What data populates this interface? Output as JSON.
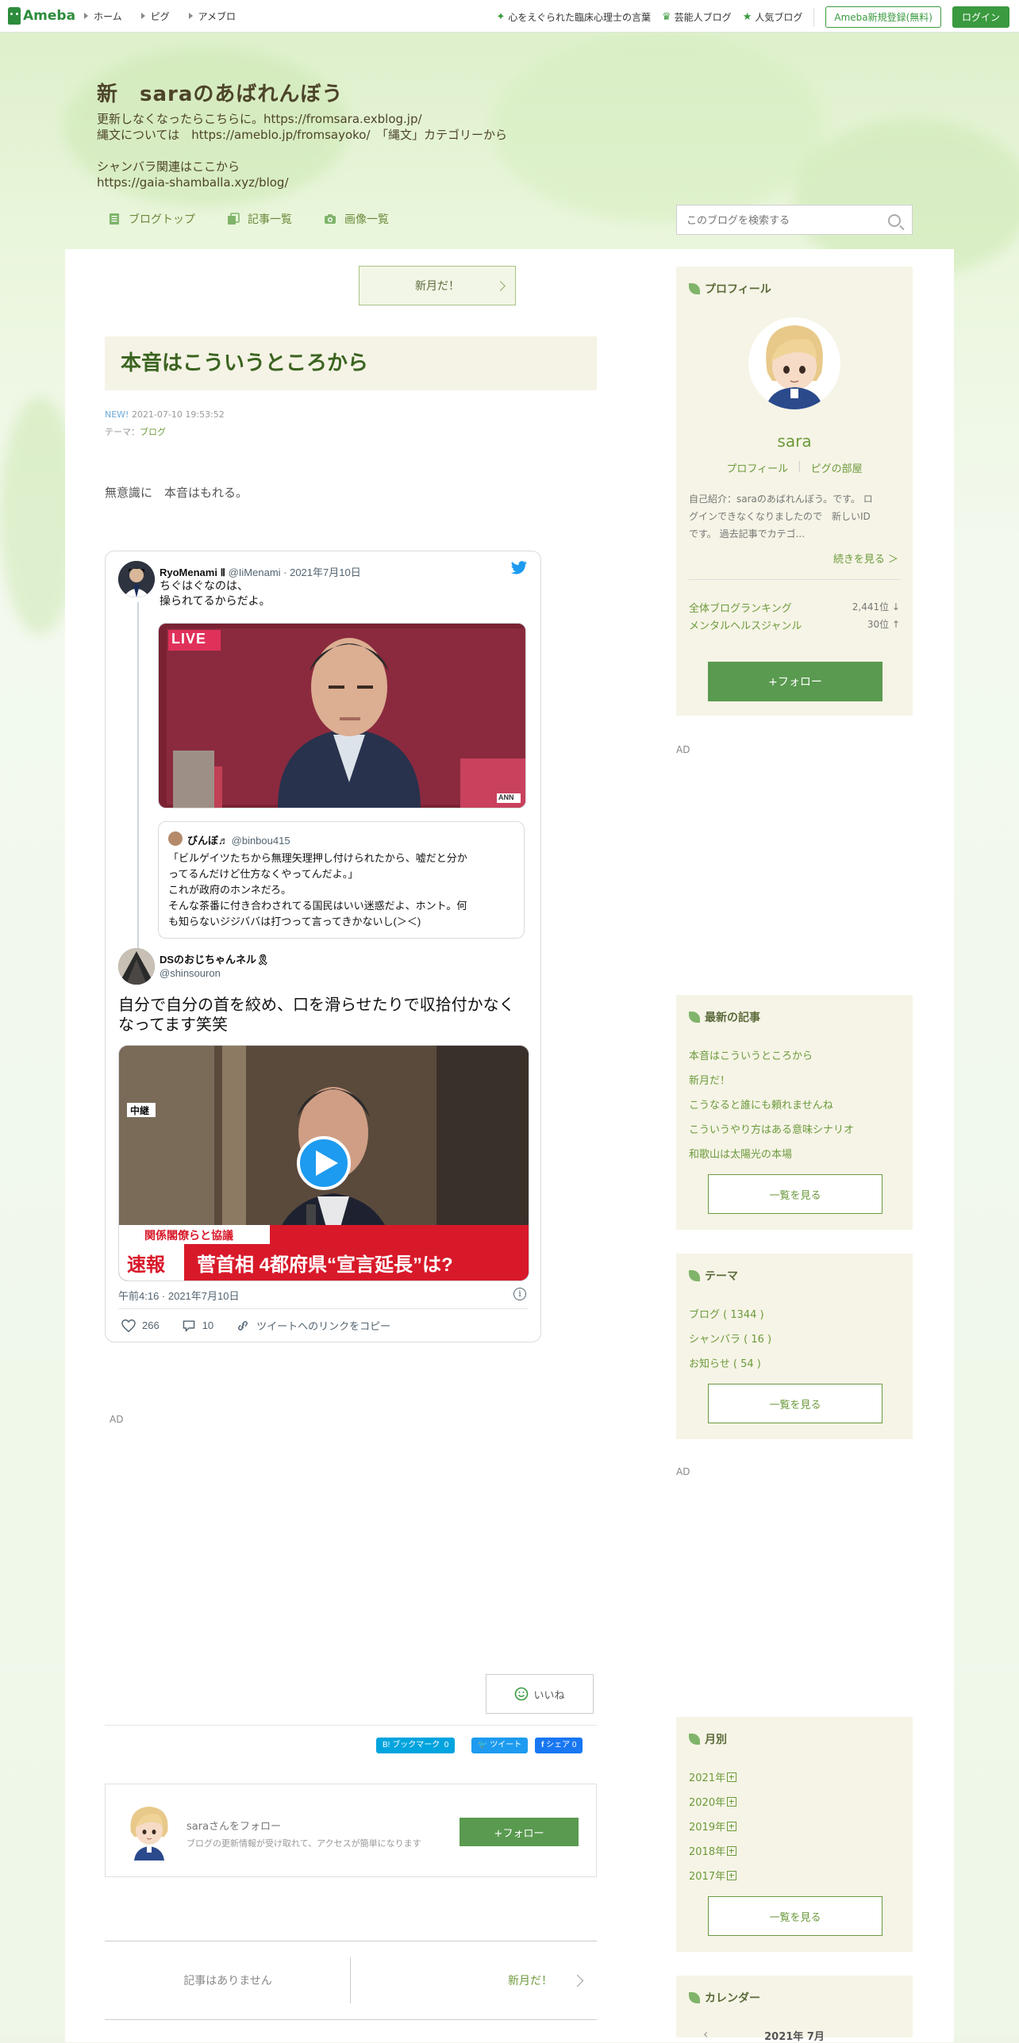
{
  "topbar": {
    "logo": "Ameba",
    "nav": [
      "ホーム",
      "ピグ",
      "アメブロ"
    ],
    "links": [
      "心をえぐられた臨床心理士の言葉",
      "芸能人ブログ",
      "人気ブログ"
    ],
    "register": "Ameba新規登録(無料)",
    "login": "ログイン"
  },
  "header": {
    "title": "新　saraのあばれんぼう",
    "description": "更新しなくなったらこちらに。https://fromsara.exblog.jp/\n縄文については　https://ameblo.jp/fromsayoko/　「縄文」カテゴリーから\n\nシャンバラ関連はここから\nhttps://gaia-shamballa.xyz/blog/",
    "nav": [
      "ブログトップ",
      "記事一覧",
      "画像一覧"
    ],
    "search_placeholder": "このブログを検索する"
  },
  "article": {
    "next_button": "新月だ！",
    "title": "本音はこういうところから",
    "new_badge": "NEW!",
    "date": "2021-07-10 19:53:52",
    "theme_label": "テーマ：",
    "theme": "ブログ",
    "body": "無意識に　本音はもれる。"
  },
  "tweet": {
    "author_name": "RyoMenami Ⅱ",
    "author_handle": "@IiMenami · 2021年7月10日",
    "text": "ちぐはぐなのは、\n操られてるからだよ。",
    "live_label": "LIVE",
    "ann_label": "ANN",
    "quote_name": "びんぼ♬",
    "quote_handle": "@binbou415",
    "quote_text": "「ビルゲイツたちから無理矢理押し付けられたから、嘘だと分か\nってるんだけど仕方なくやってんだよ。」\nこれが政府のホンネだろ。\nそんな茶番に付き合わされてる国民はいい迷惑だよ、ホント。何\nも知らないジジババは打つって言ってきかないし(＞＜)",
    "reply_name": "DSのおじちゃんネル🎗",
    "reply_handle": "@shinsouron",
    "reply_text": "自分で自分の首を絞め、口を滑らせたりで収拾付かなく\nなってます笑笑",
    "video_tag": "中継",
    "video_caption_small": "関係閣僚らと協議",
    "video_breaking": "速報",
    "video_headline": "菅首相 4都府県“宣言延長”は?",
    "timestamp": "午前4:16 · 2021年7月10日",
    "likes": "266",
    "replies": "10",
    "copy_link": "ツイートへのリンクをコピー"
  },
  "ads": [
    "AD",
    "AD",
    "AD"
  ],
  "footer": {
    "like": "いいね",
    "hatena": "B! ブックマーク",
    "hatena_count": "0",
    "tweet": "ツイート",
    "fb_share": "シェア",
    "fb_count": "0",
    "follow_title": "saraさんをフォロー",
    "follow_sub": "ブログの更新情報が受け取れて、アクセスが簡単になります",
    "follow_button": "+フォロー",
    "prev": "記事はありません",
    "next": "新月だ！"
  },
  "sidebar": {
    "profile": {
      "heading": "プロフィール",
      "name": "sara",
      "links": [
        "プロフィール",
        "ピグの部屋"
      ],
      "intro": "自己紹介：saraのあばれんぼう。です。 ロ\nグインできなくなりましたので　新しいID\nです。 過去記事でカテゴ...",
      "more": "続きを見る ＞",
      "rank1_label": "全体ブログランキング",
      "rank1_value": "2,441位 ↓",
      "rank2_label": "メンタルヘルスジャンル",
      "rank2_value": "30位 ↑",
      "follow": "+フォロー"
    },
    "recent": {
      "heading": "最新の記事",
      "items": [
        "本音はこういうところから",
        "新月だ！",
        "こうなると誰にも頼れませんね",
        "こういうやり方はある意味シナリオ",
        "和歌山は太陽光の本場"
      ],
      "more": "一覧を見る"
    },
    "themes": {
      "heading": "テーマ",
      "items": [
        "ブログ ( 1344 )",
        "シャンバラ ( 16 )",
        "お知らせ ( 54 )"
      ],
      "more": "一覧を見る"
    },
    "monthly": {
      "heading": "月別",
      "items": [
        "2021年",
        "2020年",
        "2019年",
        "2018年",
        "2017年"
      ],
      "more": "一覧を見る"
    },
    "calendar": {
      "heading": "カレンダー",
      "month": "2021年 7月"
    }
  },
  "colors": {
    "accent": "#3a9a3f",
    "title": "#3b6420",
    "link": "#6c9a3c",
    "panel": "#f6f4e6"
  }
}
